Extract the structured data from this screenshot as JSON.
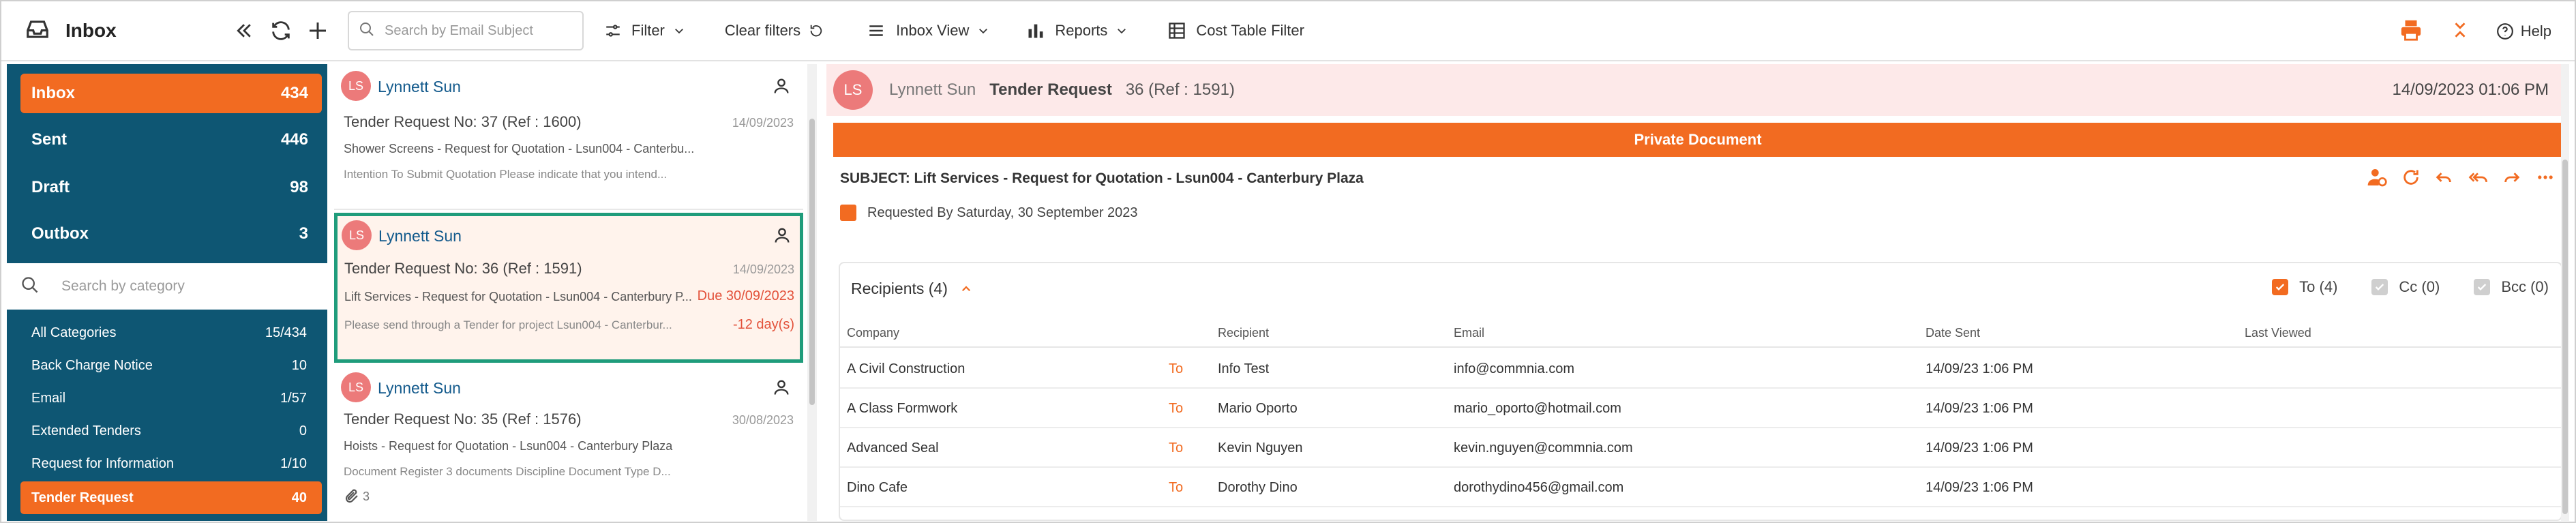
{
  "toolbar": {
    "title": "Inbox",
    "search_placeholder": "Search by Email Subject",
    "filter_label": "Filter",
    "clear_filters_label": "Clear filters",
    "inbox_view_label": "Inbox View",
    "reports_label": "Reports",
    "cost_table_filter_label": "Cost Table Filter",
    "help_label": "Help"
  },
  "folders": [
    {
      "name": "Inbox",
      "count": "434",
      "active": true
    },
    {
      "name": "Sent",
      "count": "446",
      "active": false
    },
    {
      "name": "Draft",
      "count": "98",
      "active": false
    },
    {
      "name": "Outbox",
      "count": "3",
      "active": false
    }
  ],
  "category_search_placeholder": "Search by category",
  "categories": [
    {
      "name": "All Categories",
      "count": "15/434"
    },
    {
      "name": "Back Charge Notice",
      "count": "10"
    },
    {
      "name": "Email",
      "count": "1/57"
    },
    {
      "name": "Extended Tenders",
      "count": "0"
    },
    {
      "name": "Request for Information",
      "count": "1/10"
    },
    {
      "name": "Tender Request",
      "count": "40"
    }
  ],
  "messages": [
    {
      "initials": "LS",
      "from": "Lynnett Sun",
      "subject": "Tender Request No: 37 (Ref : 1600)",
      "date": "14/09/2023",
      "preview": "Shower Screens - Request for Quotation - Lsun004 - Canterbu...",
      "preview2": "Intention To Submit Quotation Please indicate that you intend..."
    },
    {
      "initials": "LS",
      "from": "Lynnett Sun",
      "subject": "Tender Request No: 36 (Ref : 1591)",
      "date": "14/09/2023",
      "preview": "Lift Services - Request for Quotation - Lsun004 - Canterbury P...",
      "due": "Due 30/09/2023",
      "preview2": "Please send through a Tender for project Lsun004 - Canterbur...",
      "overdue": "-12 day(s)"
    },
    {
      "initials": "LS",
      "from": "Lynnett Sun",
      "subject": "Tender Request No: 35 (Ref : 1576)",
      "date": "30/08/2023",
      "preview": "Hoists - Request for Quotation - Lsun004 - Canterbury Plaza",
      "preview2": "Document Register 3 documents Discipline Document Type D...",
      "attachments": "3"
    }
  ],
  "detail": {
    "initials": "LS",
    "from": "Lynnett Sun",
    "title": "Tender Request",
    "ref": "36 (Ref : 1591)",
    "datetime": "14/09/2023 01:06 PM",
    "banner": "Private Document",
    "subject": "SUBJECT: Lift Services - Request for Quotation - Lsun004 - Canterbury Plaza",
    "requested_by": "Requested By Saturday, 30 September 2023",
    "recipients_label": "Recipients (4)",
    "filter_to": "To (4)",
    "filter_cc": "Cc (0)",
    "filter_bcc": "Bcc (0)",
    "columns": [
      "Company",
      "Recipient",
      "Email",
      "Date Sent",
      "Last Viewed"
    ],
    "rows": [
      {
        "company": "A Civil Construction",
        "type": "To",
        "recipient": "Info Test",
        "email": "info@commnia.com",
        "date_sent": "14/09/23 1:06 PM",
        "last_viewed": ""
      },
      {
        "company": "A Class Formwork",
        "type": "To",
        "recipient": "Mario Oporto",
        "email": "mario_oporto@hotmail.com",
        "date_sent": "14/09/23 1:06 PM",
        "last_viewed": ""
      },
      {
        "company": "Advanced Seal",
        "type": "To",
        "recipient": "Kevin Nguyen",
        "email": "kevin.nguyen@commnia.com",
        "date_sent": "14/09/23 1:06 PM",
        "last_viewed": ""
      },
      {
        "company": "Dino Cafe",
        "type": "To",
        "recipient": "Dorothy Dino",
        "email": "dorothydino456@gmail.com",
        "date_sent": "14/09/23 1:06 PM",
        "last_viewed": ""
      }
    ]
  },
  "colors": {
    "accent": "#f26b21",
    "sidebar": "#0e5673",
    "selected_border": "#1f9c7b",
    "link": "#135a8c"
  }
}
